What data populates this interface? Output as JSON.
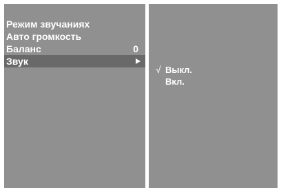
{
  "menu": {
    "items": [
      {
        "label": "Режим звучаниях",
        "value": "",
        "selected": false
      },
      {
        "label": "Авто громкость",
        "value": "",
        "selected": false
      },
      {
        "label": "Баланс",
        "value": "0",
        "selected": false
      },
      {
        "label": "Звук",
        "value": "",
        "selected": true,
        "has_submenu": true
      }
    ]
  },
  "submenu": {
    "options": [
      {
        "check": "√",
        "label": "Выкл.",
        "checked": true
      },
      {
        "check": "",
        "label": "Вкл.",
        "checked": false
      }
    ]
  },
  "colors": {
    "panel": "#909090",
    "highlight": "#696969",
    "text": "#ffffff",
    "background": "#ffffff"
  },
  "icons": {
    "submenu_arrow": "right-triangle-icon",
    "check": "checkmark-icon"
  }
}
